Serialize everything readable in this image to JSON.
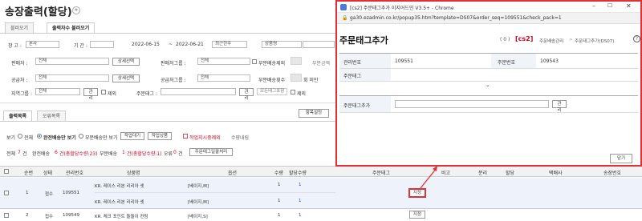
{
  "page": {
    "title": "송장출력(할당)",
    "tabs": [
      "블러오기",
      "출력차수 블러오기"
    ],
    "filters": {
      "warehouse_label": "창 고 :",
      "warehouse_value": "본사",
      "period_label": "기 간 :",
      "date_from": "2022-06-15",
      "date_sep": "~",
      "date_to": "2022-06-21",
      "period_preset": "최근한주",
      "product_name_select": "상품명",
      "seller_label": "판매처 :",
      "seller_value": "전체",
      "detail_select_1": "상세선택",
      "seller_group_label": "판매처그룹 :",
      "seller_group_value": "전체",
      "partial_ship_exclude": "부분배송제외",
      "partial_amount": "부분금액",
      "supplier_label": "공급처 :",
      "supplier_value": "전체",
      "detail_select_2": "상세선택",
      "supplier_group_label": "공급처그룹 :",
      "supplier_group_value": "전체",
      "partial_ship_count": "부분배송횟수",
      "times_below": "회 미만",
      "region_label": "지역그룹 :",
      "region_value": "전체",
      "manage_btn": "관리",
      "exclude_label": "제외",
      "order_tag_label": "주문태그 :",
      "manage_btn_2": "관리",
      "all_order_tags": "모든태그포함",
      "exclude_label_2": "제외"
    },
    "subtabs": [
      "출력목록",
      "오류목록"
    ],
    "item_settings_btn": "항목설정",
    "view": {
      "label": "보기",
      "all": "전체",
      "full_ship": "완전배송만 보기",
      "partial_ship": "부분배송만 보기",
      "work_pending_btn": "작업대기",
      "work_item_btn": "작업상품",
      "ship_instruct": "작업지시중제외",
      "qty_order": "수량내림"
    },
    "summary": {
      "total": "전체",
      "total_count": "7",
      "unit": "건",
      "full_ship": "완전배송",
      "full_ship_count": "6",
      "full_ship_detail": "건(총할당수량:23)",
      "partial_ship": "부분배송",
      "partial_ship_count": "1",
      "partial_ship_detail": "건(총할당수량:1)",
      "error": "오류",
      "error_count": "0",
      "error_unit": "건",
      "tag_bulk_btn": "주문태그일괄처리"
    },
    "table": {
      "headers": [
        "순번",
        "상태",
        "관리번호",
        "상품명",
        "옵션",
        "수량",
        "할당수량",
        "주문태그",
        "비고",
        "분리",
        "할당",
        "택배사",
        "송장번호"
      ],
      "rows": [
        {
          "no": "1",
          "status": "접수",
          "id": "109551",
          "items": [
            {
              "name": "KR. 레이스 리본 리리아 셋",
              "option": "[베이지,M]",
              "qty": "1",
              "alloc": "1"
            },
            {
              "name": "KR. 레이스 리본 리리아 셋",
              "option": "[베이지,M]",
              "qty": "1",
              "alloc": "1"
            }
          ],
          "tag_btn": "지정"
        },
        {
          "no": "2",
          "status": "접수",
          "id": "109549",
          "items": [
            {
              "name": "KR. 체크 포인트 돌돌이 컨텀",
              "option": "[베이지,S]",
              "qty": "1",
              "alloc": "1"
            }
          ],
          "tag_btn": "지정"
        }
      ]
    }
  },
  "popup": {
    "window_title": "[cs2] 주문태그추가 이지어드민 V3.5+ - Chrome",
    "url": "ga30.ezadmin.co.kr/popup35.htm?template=DS07&order_seq=109551&check_pack=1",
    "heading": "주문태그추가",
    "count_prefix": "( 0 )",
    "cs_code": "[cs2]",
    "breadcrumb_1": "주문배송관리",
    "breadcrumb_sep": ">",
    "breadcrumb_2": "주문태그추가(DS07)",
    "help": "?",
    "mgmt_no_label": "관리번호",
    "mgmt_no_value": "109551",
    "order_no_label": "주문번호",
    "order_no_value": "109543",
    "order_tag_label": "주문태그",
    "add_tag_label": "주문태그추가",
    "manage_btn": "관리",
    "close_btn": "닫기"
  },
  "colors": {
    "accent_red": "#d0021b",
    "popup_border": "#e0303a",
    "link_blue": "#1a4ec4"
  }
}
